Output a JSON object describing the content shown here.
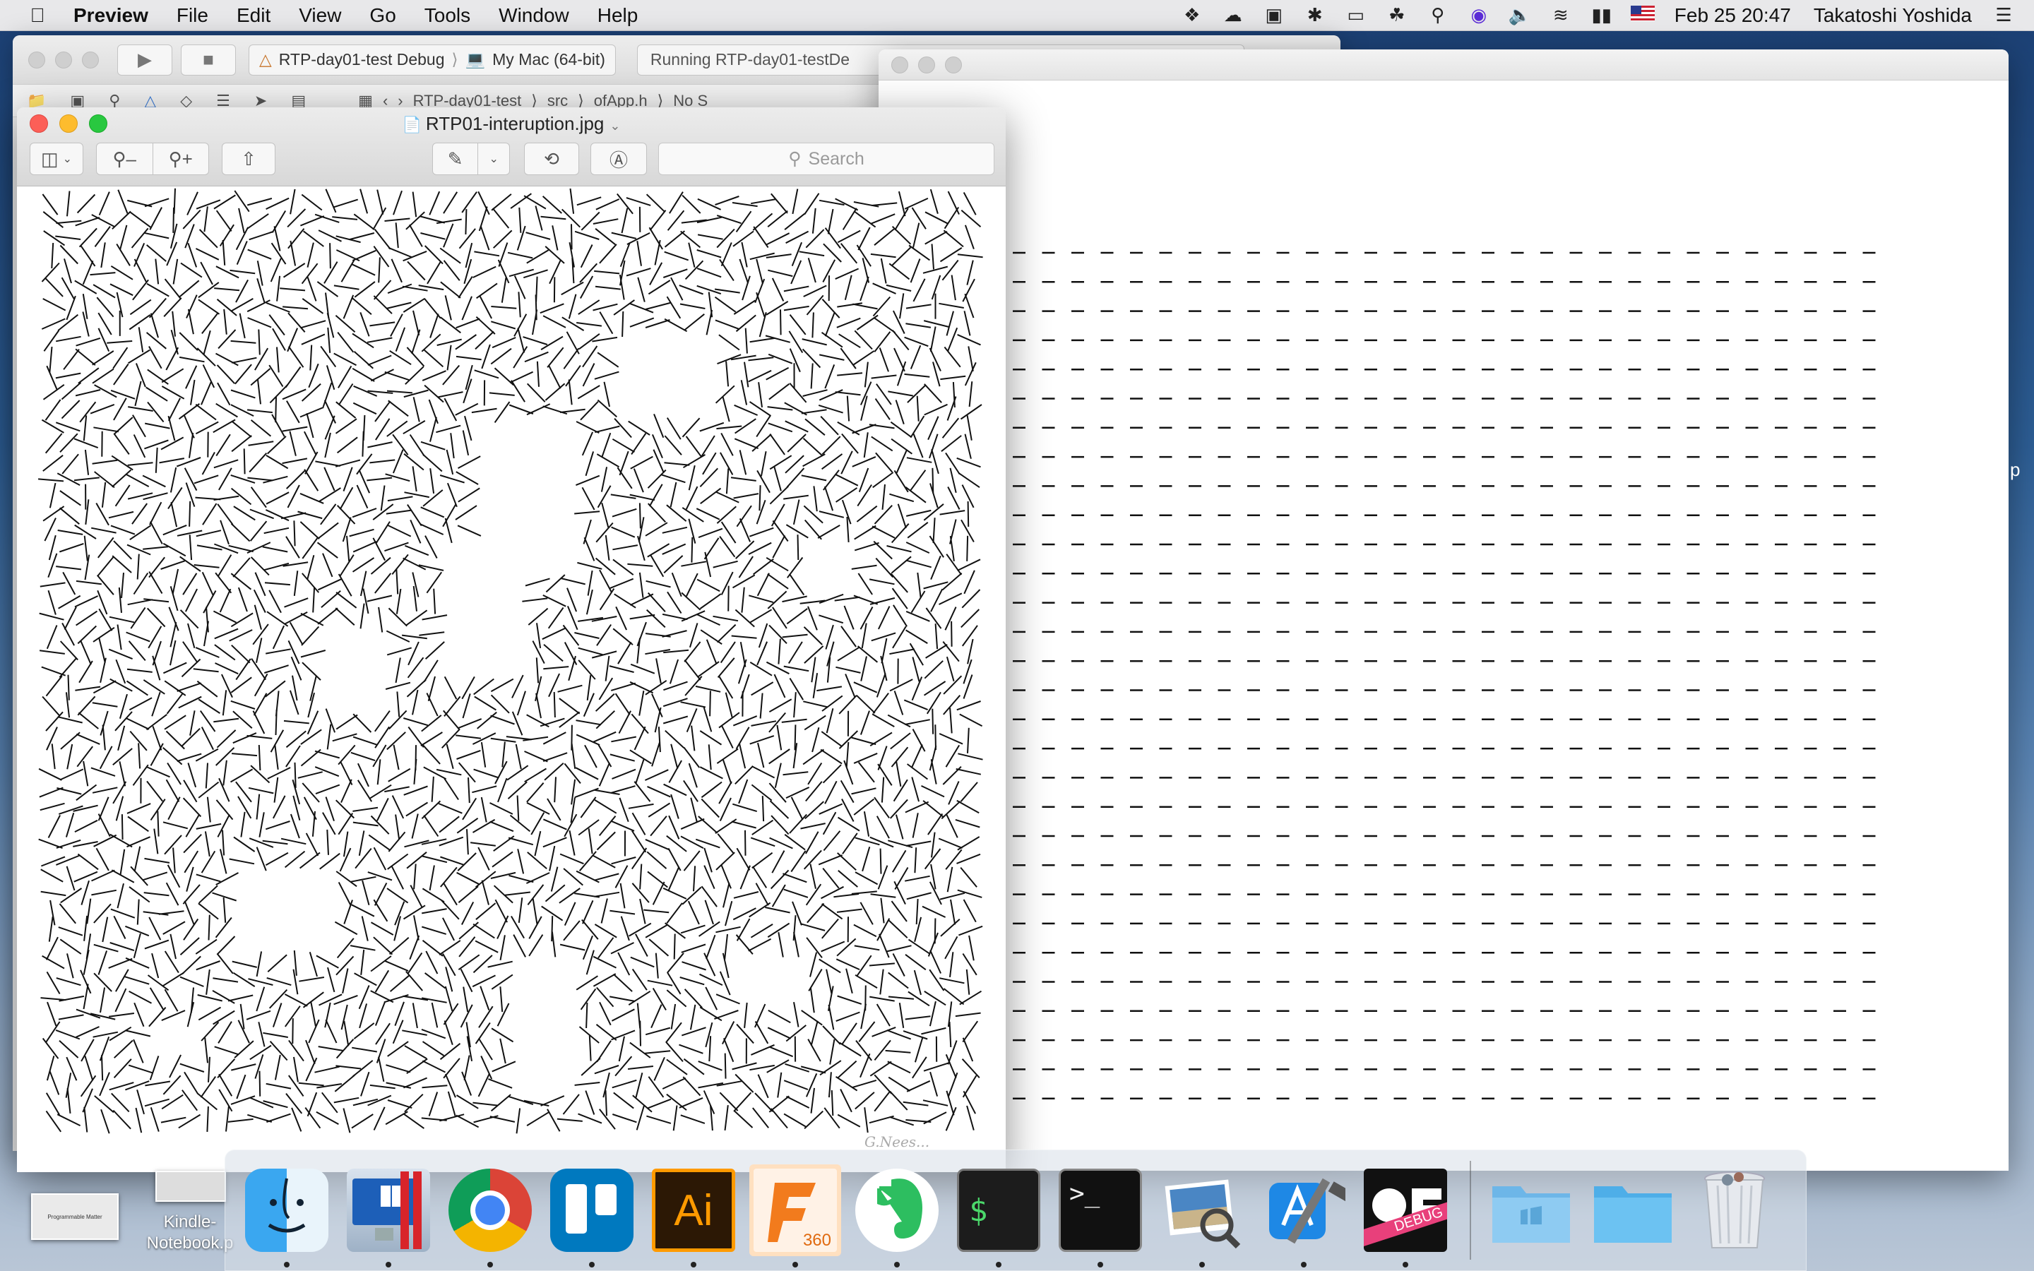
{
  "menubar": {
    "app_name": "Preview",
    "menus": [
      "File",
      "Edit",
      "View",
      "Go",
      "Tools",
      "Window",
      "Help"
    ],
    "clock": "Feb 25  20:47",
    "user": "Takatoshi Yoshida"
  },
  "xcode": {
    "scheme": "RTP-day01-test Debug",
    "destination": "My Mac (64-bit)",
    "status": "Running RTP-day01-testDe",
    "breadcrumbs": [
      "RTP-day01-test",
      "src",
      "ofApp.h",
      "No S"
    ]
  },
  "preview": {
    "title": "RTP01-interuption.jpg",
    "search_placeholder": "Search",
    "signature": "G.Nees..."
  },
  "desktop": {
    "files": [
      {
        "label": "Kindle-Notebook.p"
      }
    ],
    "edge_char": "p"
  },
  "dock": {
    "apps": [
      {
        "name": "Finder",
        "icon": "finder-icon",
        "running": true
      },
      {
        "name": "Parallels Desktop",
        "icon": "parallels-icon",
        "running": true
      },
      {
        "name": "Google Chrome",
        "icon": "chrome-icon",
        "running": true
      },
      {
        "name": "Trello",
        "icon": "trello-icon",
        "running": true
      },
      {
        "name": "Adobe Illustrator",
        "icon": "illustrator-icon",
        "label": "Ai",
        "running": true
      },
      {
        "name": "Fusion 360",
        "icon": "fusion360-icon",
        "label": "360",
        "running": true
      },
      {
        "name": "Evernote",
        "icon": "evernote-icon",
        "running": true
      },
      {
        "name": "iTerm",
        "icon": "iterm-icon",
        "label": "$",
        "running": true
      },
      {
        "name": "Terminal",
        "icon": "terminal-icon",
        "label": ">_",
        "running": true
      },
      {
        "name": "Preview",
        "icon": "preview-icon",
        "running": true
      },
      {
        "name": "Xcode",
        "icon": "xcode-icon",
        "running": true
      },
      {
        "name": "openFrameworks Debug App",
        "icon": "openframeworks-debug-icon",
        "label": "DEBUG",
        "running": true
      }
    ],
    "folders": [
      {
        "name": "Applications",
        "icon": "applications-folder-icon"
      },
      {
        "name": "Downloads",
        "icon": "downloads-folder-icon"
      },
      {
        "name": "Trash",
        "icon": "trash-icon"
      }
    ]
  },
  "colors": {
    "close": "#fc5f57",
    "minimize": "#fdbc2e",
    "maximize": "#29c840",
    "stroke": "#111111"
  }
}
